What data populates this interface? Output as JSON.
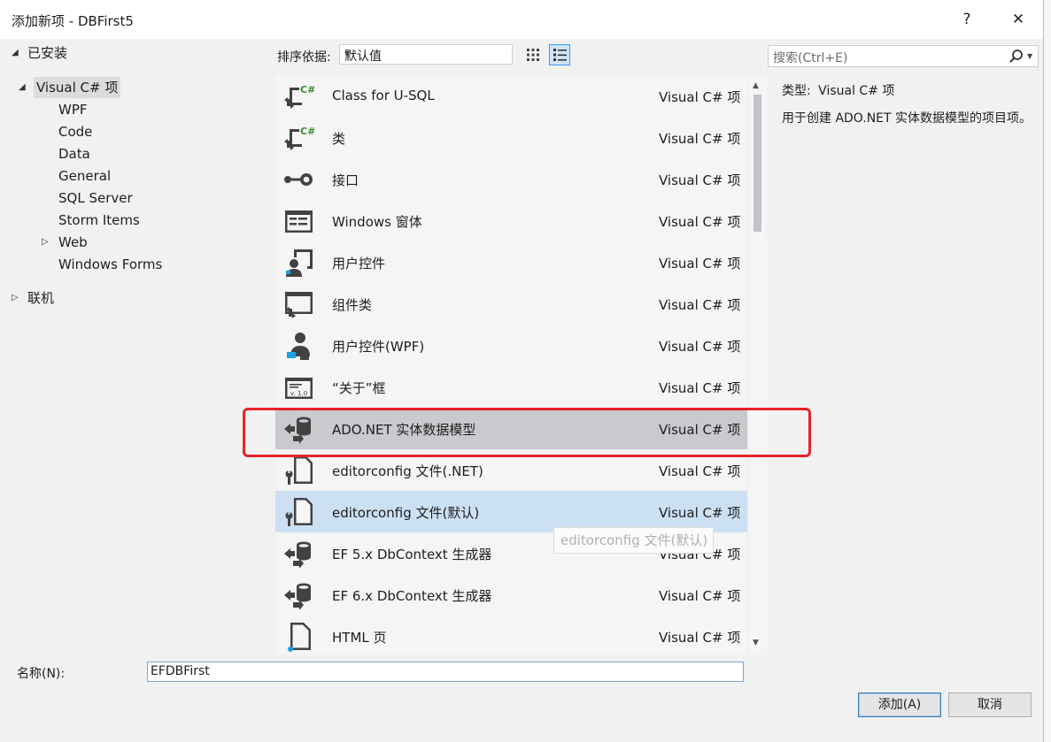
{
  "window": {
    "title": "添加新项 - DBFirst5",
    "help_glyph": "?",
    "close_glyph": "✕"
  },
  "tree": {
    "installed": "已安装",
    "root": "Visual C# 项",
    "children": [
      "WPF",
      "Code",
      "Data",
      "General",
      "SQL Server",
      "Storm Items",
      "Web",
      "Windows Forms"
    ],
    "online": "联机"
  },
  "toolbar": {
    "sort_label": "排序依据:",
    "sort_value": "默认值"
  },
  "search": {
    "placeholder": "搜索(Ctrl+E)"
  },
  "items": [
    {
      "name": "Class for U-SQL",
      "type": "Visual C# 项",
      "icon": "csharp-class-icon"
    },
    {
      "name": "类",
      "type": "Visual C# 项",
      "icon": "csharp-class-icon"
    },
    {
      "name": "接口",
      "type": "Visual C# 项",
      "icon": "interface-icon"
    },
    {
      "name": "Windows 窗体",
      "type": "Visual C# 项",
      "icon": "windows-form-icon"
    },
    {
      "name": "用户控件",
      "type": "Visual C# 项",
      "icon": "user-control-icon"
    },
    {
      "name": "组件类",
      "type": "Visual C# 项",
      "icon": "component-class-icon"
    },
    {
      "name": "用户控件(WPF)",
      "type": "Visual C# 项",
      "icon": "wpf-user-control-icon"
    },
    {
      "name": "“关于”框",
      "type": "Visual C# 项",
      "icon": "about-box-icon"
    },
    {
      "name": "ADO.NET 实体数据模型",
      "type": "Visual C# 项",
      "icon": "entity-data-model-icon"
    },
    {
      "name": "editorconfig 文件(.NET)",
      "type": "Visual C# 项",
      "icon": "editorconfig-file-icon"
    },
    {
      "name": "editorconfig 文件(默认)",
      "type": "Visual C# 项",
      "icon": "editorconfig-file-icon"
    },
    {
      "name": "EF 5.x DbContext 生成器",
      "type": "Visual C# 项",
      "icon": "dbcontext-generator-icon"
    },
    {
      "name": "EF 6.x DbContext 生成器",
      "type": "Visual C# 项",
      "icon": "dbcontext-generator-icon"
    },
    {
      "name": "HTML 页",
      "type": "Visual C# 项",
      "icon": "html-page-icon"
    }
  ],
  "tooltip": "editorconfig 文件(默认)",
  "info": {
    "type_label": "类型:",
    "type_value": "Visual C# 项",
    "description": "用于创建 ADO.NET 实体数据模型的项目项。"
  },
  "name_field": {
    "label": "名称(N):",
    "value": "EFDBFirst"
  },
  "buttons": {
    "add": "添加(A)",
    "cancel": "取消"
  },
  "colors": {
    "selected_row": "#c9c9ce",
    "hover_row": "#cce0f4",
    "highlight_box": "#e8232a"
  }
}
